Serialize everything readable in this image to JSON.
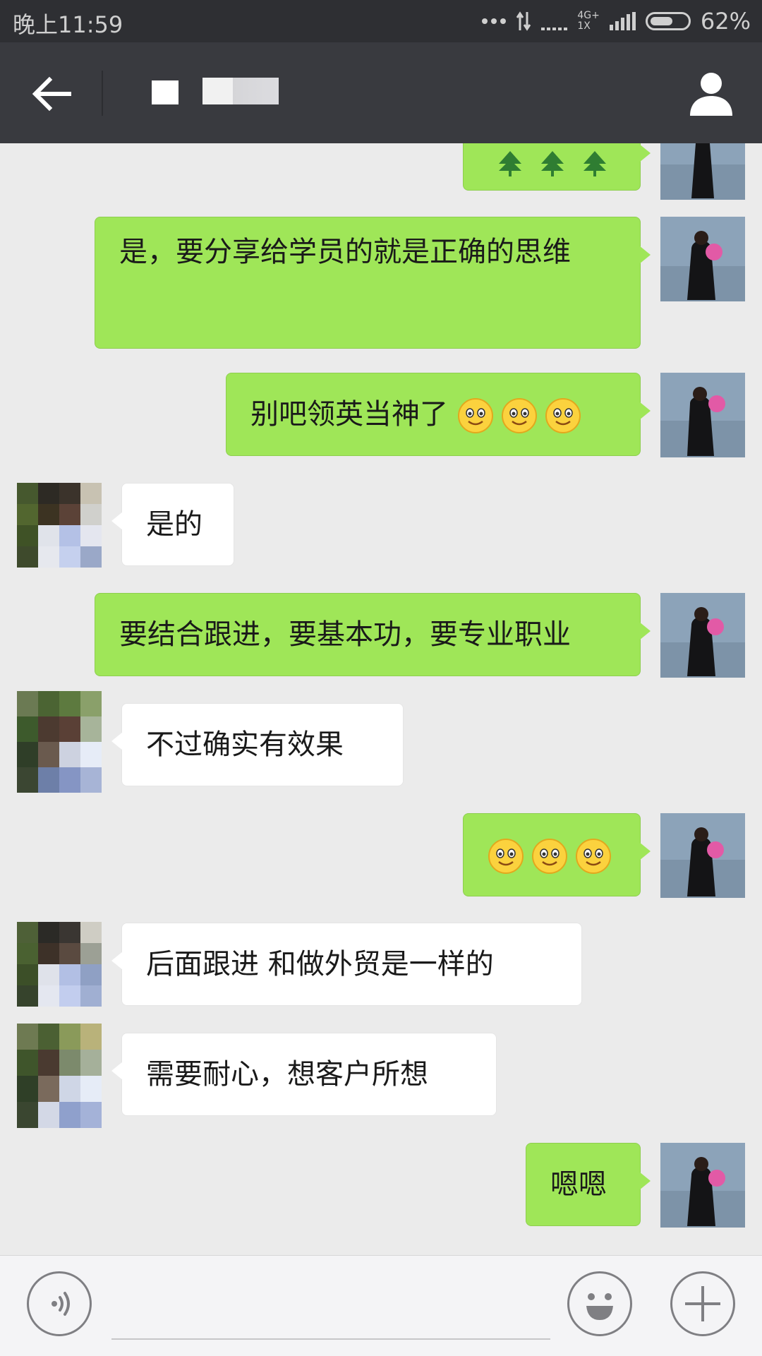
{
  "status_bar": {
    "time": "晚上11:59",
    "network_top": "4G+",
    "network_bottom": "1X",
    "battery_percent": "62%",
    "battery_level": 0.62
  },
  "header": {
    "back_icon": "back-arrow-icon",
    "profile_icon": "person-icon"
  },
  "messages": [
    {
      "sender": "me",
      "content": "🌲🌲🌲"
    },
    {
      "sender": "me",
      "text": "是，要分享给学员的就是正确的思维"
    },
    {
      "sender": "me",
      "text": "别吧领英当神了",
      "emojis": [
        "smile",
        "smile",
        "smile"
      ]
    },
    {
      "sender": "other",
      "text": "是的"
    },
    {
      "sender": "me",
      "text": "要结合跟进，要基本功，要专业职业"
    },
    {
      "sender": "other",
      "text": "不过确实有效果"
    },
    {
      "sender": "me",
      "text": "",
      "emojis": [
        "smile",
        "smile",
        "smile"
      ]
    },
    {
      "sender": "other",
      "text": "后面跟进 和做外贸是一样的"
    },
    {
      "sender": "other",
      "text": "需要耐心，想客户所想"
    },
    {
      "sender": "me",
      "text": "嗯嗯"
    }
  ],
  "input_bar": {
    "voice_icon": "voice-icon",
    "emoji_icon": "emoji-icon",
    "plus_icon": "plus-icon"
  },
  "colors": {
    "status_bar_bg": "#2e2f33",
    "header_bg": "#393a3f",
    "chat_bg": "#ebebeb",
    "my_bubble": "#9fe658",
    "their_bubble": "#ffffff"
  }
}
